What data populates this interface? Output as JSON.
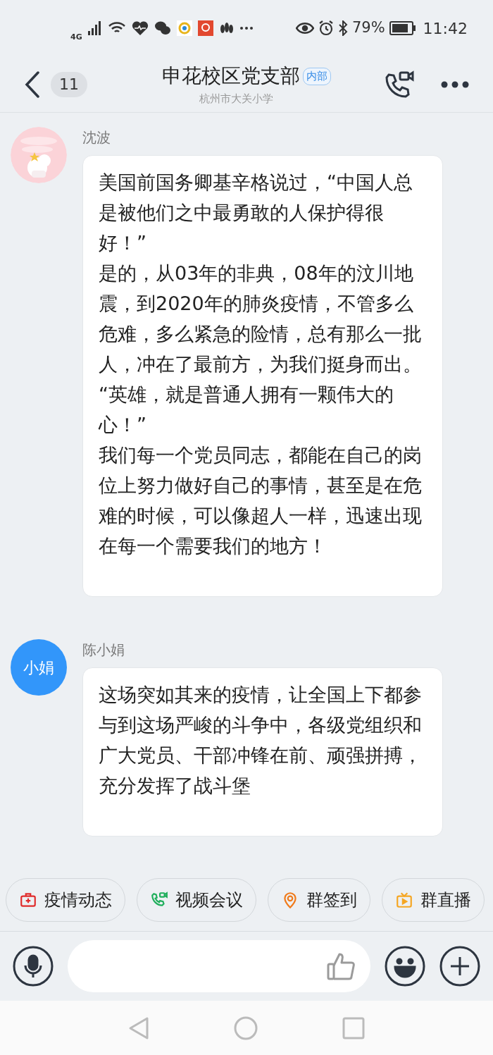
{
  "status_bar": {
    "network": "4G",
    "battery": "79%",
    "time": "11:42"
  },
  "header": {
    "back_count": "11",
    "title": "申花校区党支部",
    "badge": "内部",
    "subtitle": "杭州市大关小学"
  },
  "messages": [
    {
      "sender": "沈波",
      "paragraphs": [
        "美国前国务卿基辛格说过，“中国人总是被他们之中最勇敢的人保护得很好！”",
        "是的，从03年的非典，08年的汶川地震，到2020年的肺炎疫情，不管多么危难，多么紧急的险情，总有那么一批人，冲在了最前方，为我们挺身而出。",
        "“英雄，就是普通人拥有一颗伟大的心！”",
        "我们每一个党员同志，都能在自己的岗位上努力做好自己的事情，甚至是在危难的时候，可以像超人一样，迅速出现在每一个需要我们的地方！"
      ]
    },
    {
      "sender": "陈小娟",
      "avatar": {
        "kind": "text",
        "text": "小娟"
      },
      "paragraphs": [
        "这场突如其来的疫情，让全国上下都参与到这场严峻的斗争中，各级党组织和广大党员、干部冲锋在前、顽强拼搏，充分发挥了战斗堡"
      ]
    }
  ],
  "quick_actions": [
    {
      "kind": "medkit",
      "label": "疫情动态"
    },
    {
      "kind": "video",
      "label": "视频会议"
    },
    {
      "kind": "location",
      "label": "群签到"
    },
    {
      "kind": "live",
      "label": "群直播"
    }
  ]
}
